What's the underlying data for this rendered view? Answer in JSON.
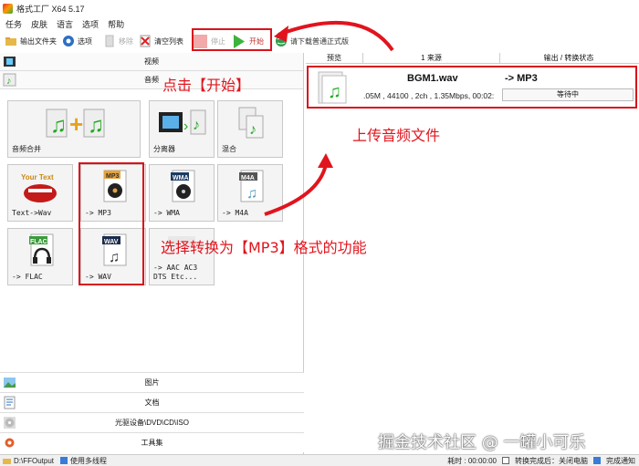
{
  "window": {
    "title": "格式工厂 X64 5.17"
  },
  "menu": [
    "任务",
    "皮肤",
    "语言",
    "选项",
    "帮助"
  ],
  "toolbar": {
    "output_folder": "输出文件夹",
    "options": "选项",
    "remove": "移除",
    "clear_list": "清空列表",
    "stop": "停止",
    "start": "开始",
    "download_label": "请下载普通正式版"
  },
  "left": {
    "cat_video": "视频",
    "cat_audio": "音频",
    "tiles": [
      {
        "label": "音频合并",
        "icon": "audio-merge-icon"
      },
      {
        "label": "分离器",
        "icon": "splitter-icon"
      },
      {
        "label": "混合",
        "icon": "mix-icon"
      },
      {
        "label": "Text->Wav",
        "icon": "text-to-wav-icon"
      },
      {
        "label": "-> MP3",
        "icon": "mp3-icon",
        "badge": "MP3"
      },
      {
        "label": "-> WMA",
        "icon": "wma-icon",
        "badge": "WMA"
      },
      {
        "label": "-> M4A",
        "icon": "m4a-icon",
        "badge": "M4A"
      },
      {
        "label": "-> FLAC",
        "icon": "flac-icon",
        "badge": "FLAC"
      },
      {
        "label": "-> WAV",
        "icon": "wav-icon",
        "badge": "WAV"
      },
      {
        "label": "-> AAC AC3\nDTS Etc...",
        "icon": "aac-ac3-icon"
      }
    ],
    "bottom_cats": [
      "图片",
      "文档",
      "光驱设备\\DVD\\CD\\ISO",
      "工具集"
    ]
  },
  "table": {
    "col_preview": "预览",
    "col_source": "1 来源",
    "col_output": "输出 / 转换状态",
    "row": {
      "filename": "BGM1.wav",
      "target": "-> MP3",
      "info": ".05M , 44100 , 2ch , 1.35Mbps, 00:02:",
      "status": "等待中"
    }
  },
  "statusbar": {
    "output_path": "D:\\FFOutput",
    "multithread": "使用多线程",
    "elapsed": "耗时 : 00:00:00",
    "after_convert": "转换完成后：关闭电脑",
    "notify": "完成通知"
  },
  "annotations": {
    "click_start": "点击【开始】",
    "upload": "上传音频文件",
    "choose_mp3": "选择转换为【MP3】格式的功能"
  },
  "watermark": "掘金技术社区 @ 一罐小可乐",
  "colors": {
    "highlight_red": "#d9121b",
    "annotation_red": "#e1141d"
  }
}
